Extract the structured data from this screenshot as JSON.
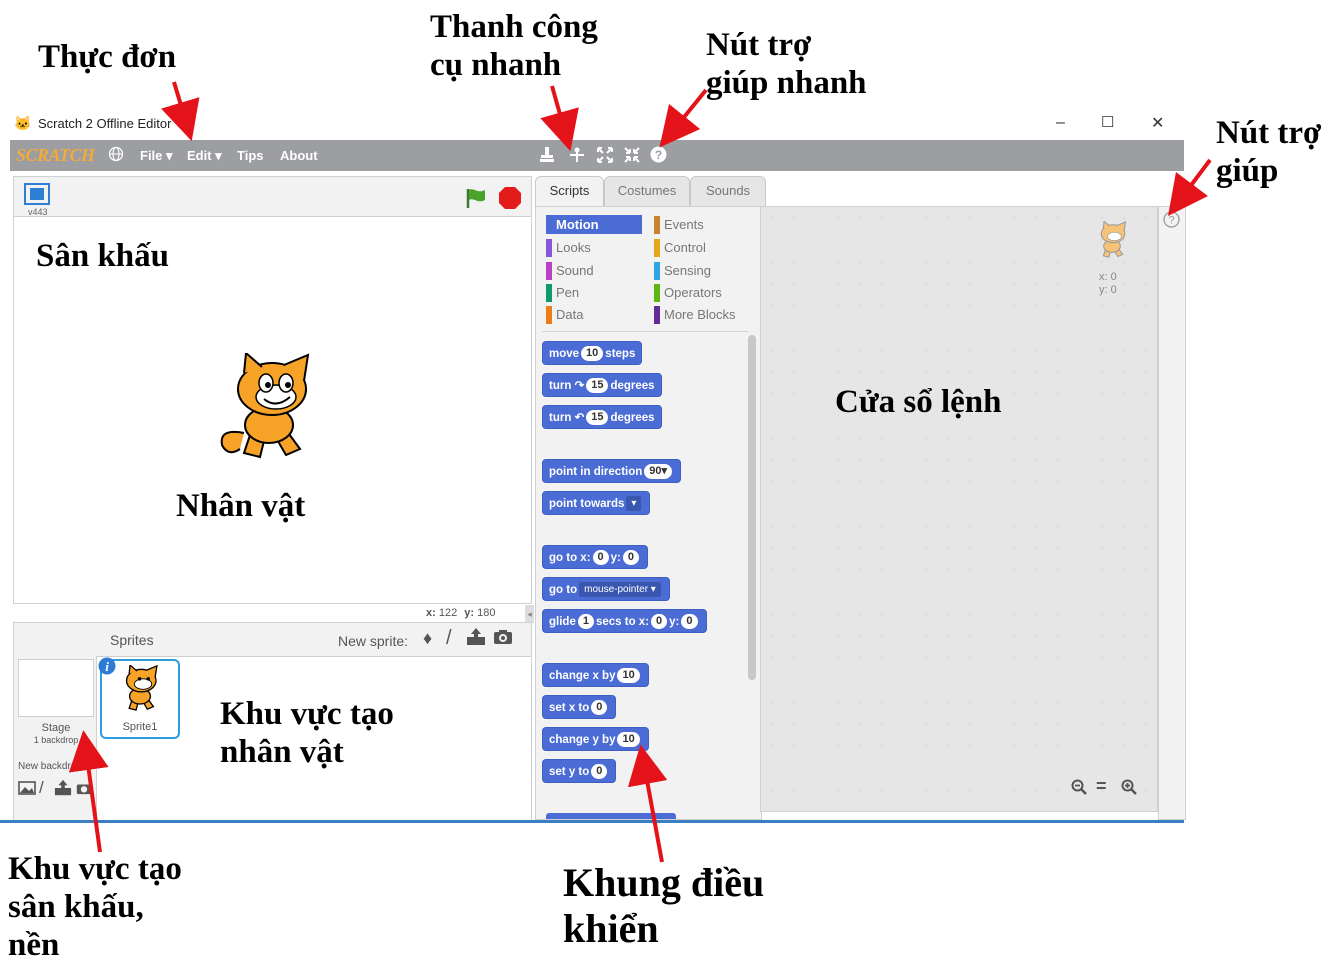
{
  "annotations": {
    "menu": "Thực đơn",
    "toolbar_1": "Thanh công",
    "toolbar_2": "cụ nhanh",
    "quick_help_1": "Nút trợ",
    "quick_help_2": "giúp nhanh",
    "help_1": "Nút trợ",
    "help_2": "giúp",
    "stage": "Sân khấu",
    "sprite": "Nhân vật",
    "scripts_area": "Cửa sổ lệnh",
    "sprite_area_1": "Khu vực tạo",
    "sprite_area_2": "nhân vật",
    "stage_area_1": "Khu vực tạo",
    "stage_area_2": "sân khấu,",
    "stage_area_3": "nền",
    "palette_1": "Khung điều",
    "palette_2": "khiển"
  },
  "window": {
    "title": "Scratch 2 Offline Editor",
    "minimize": "–",
    "maximize": "☐",
    "close": "✕"
  },
  "menubar": {
    "logo": "SCRATCH",
    "file": "File ▾",
    "edit": "Edit ▾",
    "tips": "Tips",
    "about": "About"
  },
  "stage_panel": {
    "version": "v443",
    "coords_x_label": "x:",
    "coords_x": "122",
    "coords_y_label": "y:",
    "coords_y": "180"
  },
  "sprites_panel": {
    "title": "Sprites",
    "new_sprite_label": "New sprite:",
    "stage_label": "Stage",
    "stage_backdrops": "1 backdrop",
    "new_backdrop_label": "New backdrop:",
    "sprite1_name": "Sprite1"
  },
  "tabs": [
    "Scripts",
    "Costumes",
    "Sounds"
  ],
  "categories": [
    {
      "label": "Motion",
      "color": "#4a6cd4"
    },
    {
      "label": "Looks",
      "color": "#8a55d7"
    },
    {
      "label": "Sound",
      "color": "#bb42c3"
    },
    {
      "label": "Pen",
      "color": "#0e9a6c"
    },
    {
      "label": "Data",
      "color": "#ee7d16"
    },
    {
      "label": "Events",
      "color": "#c88330"
    },
    {
      "label": "Control",
      "color": "#e1a91a"
    },
    {
      "label": "Sensing",
      "color": "#2ca5e2"
    },
    {
      "label": "Operators",
      "color": "#5cb712"
    },
    {
      "label": "More Blocks",
      "color": "#632d99"
    }
  ],
  "blocks": {
    "move_a": "move",
    "move_n": "10",
    "move_b": "steps",
    "turn_cw_a": "turn",
    "turn_cw_n": "15",
    "turn_cw_b": "degrees",
    "turn_ccw_a": "turn",
    "turn_ccw_n": "15",
    "turn_ccw_b": "degrees",
    "point_dir": "point in direction",
    "point_dir_n": "90▾",
    "point_towards": "point towards",
    "goto_xy_a": "go to x:",
    "goto_xy_x": "0",
    "goto_xy_b": "y:",
    "goto_xy_y": "0",
    "goto_a": "go to",
    "goto_dd": "mouse-pointer ▾",
    "glide_a": "glide",
    "glide_n": "1",
    "glide_b": "secs to x:",
    "glide_x": "0",
    "glide_c": "y:",
    "glide_y": "0",
    "change_x": "change x by",
    "change_x_n": "10",
    "set_x": "set x to",
    "set_x_n": "0",
    "change_y": "change y by",
    "change_y_n": "10",
    "set_y": "set y to",
    "set_y_n": "0"
  },
  "scripts_area": {
    "x_label": "x: 0",
    "y_label": "y: 0",
    "zoom_out": "−",
    "zoom_reset": "=",
    "zoom_in": "+"
  }
}
